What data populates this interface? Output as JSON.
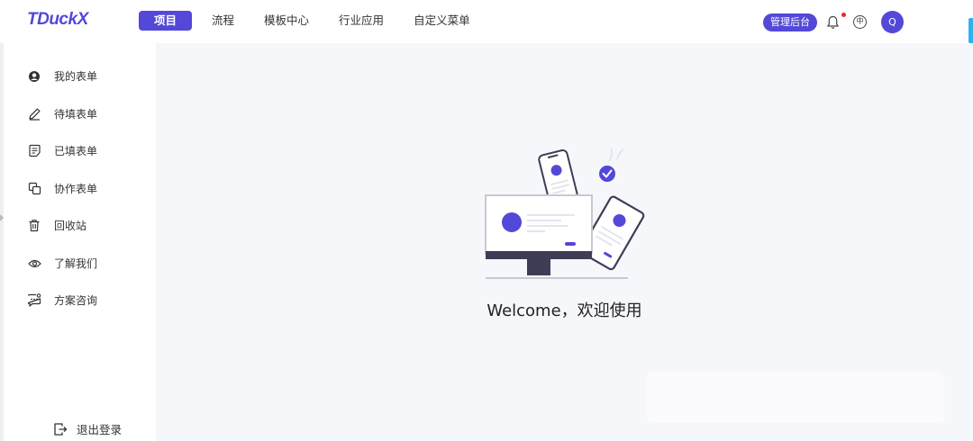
{
  "app": {
    "logo": "TDuckX"
  },
  "nav": {
    "items": [
      {
        "label": "项目",
        "active": true
      },
      {
        "label": "流程"
      },
      {
        "label": "模板中心"
      },
      {
        "label": "行业应用"
      },
      {
        "label": "自定义菜单"
      }
    ]
  },
  "header": {
    "admin_label": "管理后台",
    "lang_label": "中",
    "avatar_letter": "Q",
    "notification_dot": true
  },
  "sidebar": {
    "items": [
      {
        "label": "我的表单",
        "icon": "user-circle-icon"
      },
      {
        "label": "待填表单",
        "icon": "pencil-icon"
      },
      {
        "label": "已填表单",
        "icon": "document-list-icon"
      },
      {
        "label": "协作表单",
        "icon": "copy-icon"
      },
      {
        "label": "回收站",
        "icon": "trash-icon"
      },
      {
        "label": "了解我们",
        "icon": "eye-icon"
      },
      {
        "label": "方案咨询",
        "icon": "chat-icon"
      }
    ],
    "logout_label": "退出登录"
  },
  "main": {
    "welcome_text": "Welcome，欢迎使用"
  },
  "colors": {
    "primary": "#5348d8",
    "main_bg": "#f6f7fb",
    "dark": "#3f3d56",
    "edge_tab": "#2fb3f0",
    "notify": "#f5222d"
  }
}
